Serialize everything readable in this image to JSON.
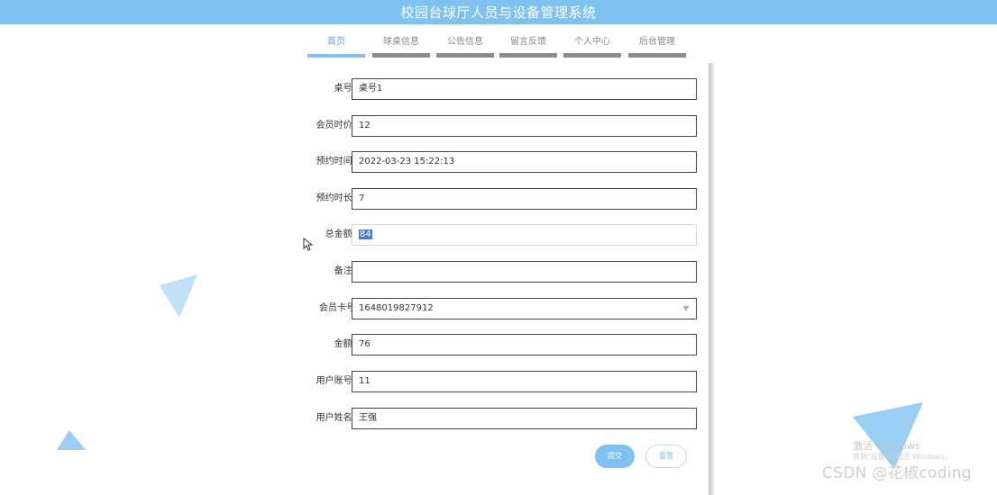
{
  "app": {
    "title": "校园台球厅人员与设备管理系统"
  },
  "nav": {
    "items": [
      {
        "label": "首页",
        "active": true
      },
      {
        "label": "球桌信息",
        "active": false
      },
      {
        "label": "公告信息",
        "active": false
      },
      {
        "label": "留言反馈",
        "active": false
      },
      {
        "label": "个人中心",
        "active": false
      },
      {
        "label": "后台管理",
        "active": false
      }
    ]
  },
  "form": {
    "fields": [
      {
        "label": "桌号:",
        "value": "桌号1"
      },
      {
        "label": "会员时价:",
        "value": "12"
      },
      {
        "label": "预约时间:",
        "value": "2022-03-23 15:22:13"
      },
      {
        "label": "预约时长:",
        "value": "7"
      },
      {
        "label": "总金额:",
        "value": "84",
        "disabled": true,
        "selected": true
      },
      {
        "label": "备注:",
        "value": ""
      },
      {
        "label": "会员卡号",
        "value": "1648019827912",
        "type": "select"
      },
      {
        "label": "金额:",
        "value": "76"
      },
      {
        "label": "用户账号:",
        "value": "11"
      },
      {
        "label": "用户姓名:",
        "value": "王强"
      }
    ],
    "submit_label": "提交",
    "reset_label": "重置"
  },
  "watermark": {
    "windows_line1": "激活 Windows",
    "windows_line2": "转到\"设置\"以激活 Windows。",
    "csdn": "CSDN @花椒coding"
  },
  "colors": {
    "header_bg": "#7fc2f2",
    "accent": "#7fc2f2",
    "nav_bar": "#8c8c8c",
    "selection": "#3b83d1"
  },
  "icons": {
    "select_caret": "chevron-down-icon",
    "cursor": "mouse-pointer-icon"
  }
}
